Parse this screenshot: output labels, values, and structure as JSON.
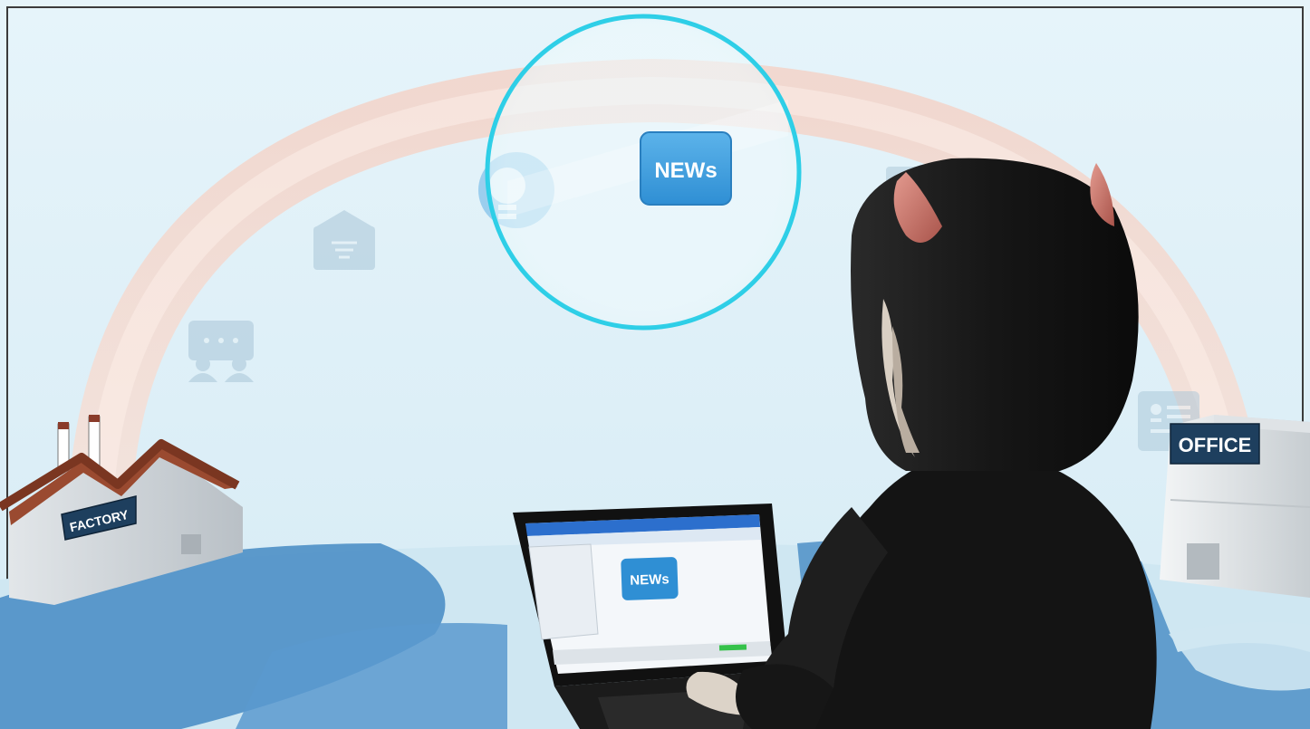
{
  "scene": {
    "factory_sign": "FACTORY",
    "office_sign": "OFFICE",
    "highlighted_icon_label": "NEWs",
    "laptop_screen_label": "NEWs",
    "colors": {
      "sky": "#dbeef7",
      "arc": "#f6d7cc",
      "ground": "#4d8fc7",
      "highlight_ring": "#27cde6",
      "news_tile": "#3b9ee0",
      "hoodie": "#1a1a1a",
      "horns": "#c97368",
      "sign_bg": "#1e3f5e"
    },
    "arc_icons": [
      "chat-people-icon",
      "envelope-icon",
      "lightbulb-icon",
      "news-icon",
      "document-icon",
      "contact-card-icon"
    ]
  }
}
